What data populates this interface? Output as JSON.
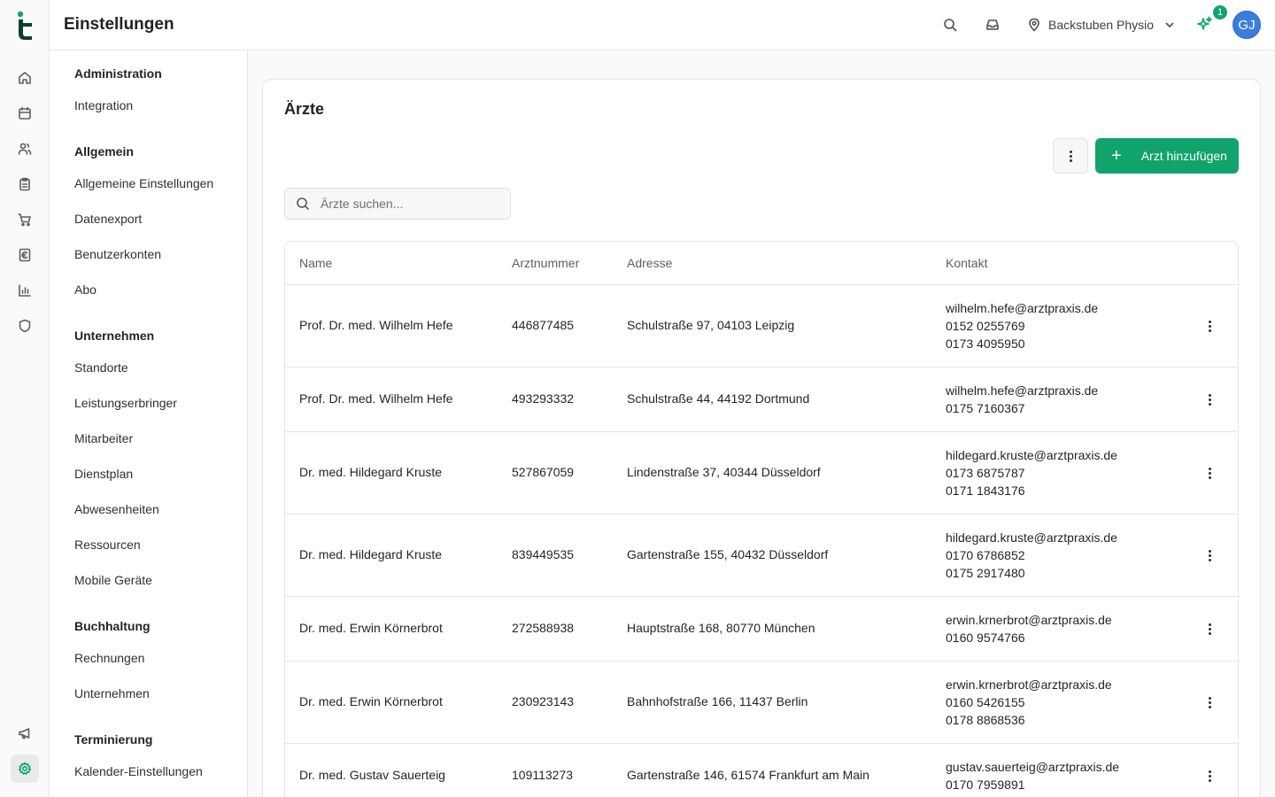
{
  "header": {
    "title": "Einstellungen",
    "location": "Backstuben Physio",
    "notification_count": "1",
    "avatar_initials": "GJ"
  },
  "rail": {
    "icons": [
      "home-icon",
      "calendar-icon",
      "users-icon",
      "clipboard-icon",
      "cart-icon",
      "euro-icon",
      "chart-icon",
      "shield-icon",
      "megaphone-icon",
      "gear-icon"
    ],
    "active": "gear-icon"
  },
  "settings_nav": {
    "groups": [
      {
        "label": "Administration",
        "items": [
          "Integration"
        ]
      },
      {
        "label": "Allgemein",
        "items": [
          "Allgemeine Einstellungen",
          "Datenexport",
          "Benutzerkonten",
          "Abo"
        ]
      },
      {
        "label": "Unternehmen",
        "items": [
          "Standorte",
          "Leistungserbringer",
          "Mitarbeiter",
          "Dienstplan",
          "Abwesenheiten",
          "Ressourcen",
          "Mobile Geräte"
        ]
      },
      {
        "label": "Buchhaltung",
        "items": [
          "Rechnungen",
          "Unternehmen"
        ]
      },
      {
        "label": "Terminierung",
        "items": [
          "Kalender-Einstellungen"
        ]
      }
    ]
  },
  "main": {
    "title": "Ärzte",
    "add_button_label": "Arzt hinzufügen",
    "search_placeholder": "Ärzte suchen...",
    "columns": [
      "Name",
      "Arztnummer",
      "Adresse",
      "Kontakt"
    ],
    "rows": [
      {
        "name": "Prof. Dr. med. Wilhelm Hefe",
        "number": "446877485",
        "address": "Schulstraße 97, 04103 Leipzig",
        "contact": [
          "wilhelm.hefe@arztpraxis.de",
          "0152 0255769",
          "0173 4095950"
        ]
      },
      {
        "name": "Prof. Dr. med. Wilhelm Hefe",
        "number": "493293332",
        "address": "Schulstraße 44, 44192 Dortmund",
        "contact": [
          "wilhelm.hefe@arztpraxis.de",
          "0175 7160367"
        ]
      },
      {
        "name": "Dr. med. Hildegard Kruste",
        "number": "527867059",
        "address": "Lindenstraße 37, 40344 Düsseldorf",
        "contact": [
          "hildegard.kruste@arztpraxis.de",
          "0173 6875787",
          "0171 1843176"
        ]
      },
      {
        "name": "Dr. med. Hildegard Kruste",
        "number": "839449535",
        "address": "Gartenstraße 155, 40432 Düsseldorf",
        "contact": [
          "hildegard.kruste@arztpraxis.de",
          "0170 6786852",
          "0175 2917480"
        ]
      },
      {
        "name": "Dr. med. Erwin Körnerbrot",
        "number": "272588938",
        "address": "Hauptstraße 168, 80770 München",
        "contact": [
          "erwin.krnerbrot@arztpraxis.de",
          "0160 9574766"
        ]
      },
      {
        "name": "Dr. med. Erwin Körnerbrot",
        "number": "230923143",
        "address": "Bahnhofstraße 166, 11437 Berlin",
        "contact": [
          "erwin.krnerbrot@arztpraxis.de",
          "0160 5426155",
          "0178 8868536"
        ]
      },
      {
        "name": "Dr. med. Gustav Sauerteig",
        "number": "109113273",
        "address": "Gartenstraße 146, 61574 Frankfurt am Main",
        "contact": [
          "gustav.sauerteig@arztpraxis.de",
          "0170 7959891"
        ]
      }
    ]
  },
  "colors": {
    "brand": "#10a36b",
    "avatar": "#3b7ddd"
  }
}
